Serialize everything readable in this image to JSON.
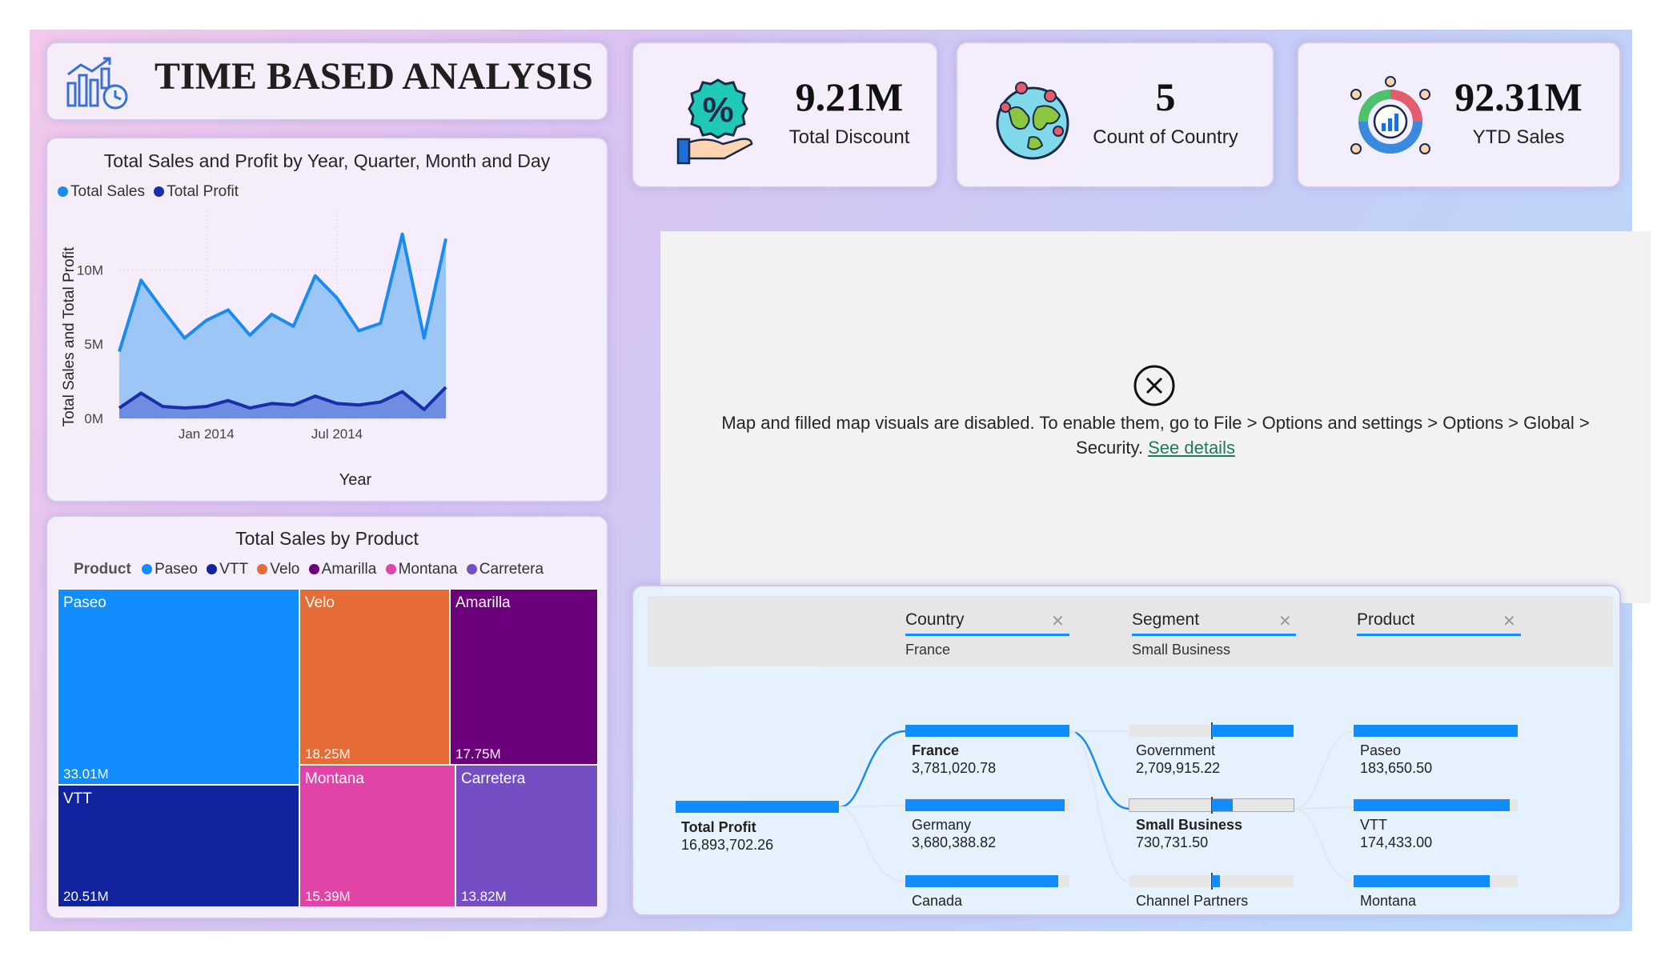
{
  "header": {
    "title": "TIME BASED ANALYSIS",
    "icon": "analytics-chart-icon"
  },
  "kpis": [
    {
      "value": "9.21M",
      "label": "Total Discount",
      "icon": "discount-hand-icon"
    },
    {
      "value": "5",
      "label": "Count of Country",
      "icon": "globe-pins-icon"
    },
    {
      "value": "92.31M",
      "label": "YTD Sales",
      "icon": "people-chart-icon"
    }
  ],
  "area_chart": {
    "title": "Total Sales and Profit by Year, Quarter, Month and Day",
    "legend": [
      {
        "name": "Total Sales",
        "color": "#1a8cf0"
      },
      {
        "name": "Total Profit",
        "color": "#1a2ea8"
      }
    ],
    "ylabel": "Total Sales and Total Profit",
    "xlabel": "Year",
    "y_ticks": [
      "0M",
      "5M",
      "10M"
    ],
    "x_ticks": [
      "Jan 2014",
      "Jul 2014"
    ]
  },
  "treemap": {
    "title": "Total Sales by Product",
    "legend_title": "Product",
    "legend": [
      {
        "name": "Paseo",
        "color": "#118dff"
      },
      {
        "name": "VTT",
        "color": "#12239e"
      },
      {
        "name": "Velo",
        "color": "#e66c37"
      },
      {
        "name": "Amarilla",
        "color": "#6b007b"
      },
      {
        "name": "Montana",
        "color": "#e044a7"
      },
      {
        "name": "Carretera",
        "color": "#744ec2"
      }
    ],
    "cells": [
      {
        "name": "Paseo",
        "value": "33.01M"
      },
      {
        "name": "Velo",
        "value": "18.25M"
      },
      {
        "name": "Amarilla",
        "value": "17.75M"
      },
      {
        "name": "VTT",
        "value": "20.51M"
      },
      {
        "name": "Montana",
        "value": "15.39M"
      },
      {
        "name": "Carretera",
        "value": "13.82M"
      }
    ]
  },
  "map_panel": {
    "message": "Map and filled map visuals are disabled. To enable them, go to File > Options and settings > Options > Global > Security.",
    "link": "See details",
    "icon": "close-circle-icon"
  },
  "decomposition_tree": {
    "columns": [
      {
        "title": "Country",
        "selected": "France"
      },
      {
        "title": "Segment",
        "selected": "Small Business"
      },
      {
        "title": "Product",
        "selected": ""
      }
    ],
    "root": {
      "label": "Total Profit",
      "value": "16,893,702.26"
    },
    "country_nodes": [
      {
        "label": "France",
        "value": "3,781,020.78",
        "fill": 1.0
      },
      {
        "label": "Germany",
        "value": "3,680,388.82",
        "fill": 0.97
      },
      {
        "label": "Canada",
        "value": "",
        "fill": 0.93
      }
    ],
    "segment_nodes": [
      {
        "label": "Government",
        "value": "2,709,915.22",
        "fill": 0.5
      },
      {
        "label": "Small Business",
        "value": "730,731.50",
        "fill": 0.13
      },
      {
        "label": "Channel Partners",
        "value": "",
        "fill": 0.05
      }
    ],
    "product_nodes": [
      {
        "label": "Paseo",
        "value": "183,650.50",
        "fill": 1.0
      },
      {
        "label": "VTT",
        "value": "174,433.00",
        "fill": 0.95
      },
      {
        "label": "Montana",
        "value": "",
        "fill": 0.83
      }
    ]
  },
  "chart_data": {
    "type": "area",
    "title": "Total Sales and Profit by Year, Quarter, Month and Day",
    "xlabel": "Year",
    "ylabel": "Total Sales and Total Profit",
    "x": [
      "Sep 2013",
      "Oct 2013",
      "Nov 2013",
      "Dec 2013",
      "Jan 2014",
      "Feb 2014",
      "Mar 2014",
      "Apr 2014",
      "May 2014",
      "Jun 2014",
      "Jul 2014",
      "Aug 2014",
      "Sep 2014",
      "Oct 2014",
      "Nov 2014",
      "Dec 2014"
    ],
    "x_tick_labels": [
      "Jan 2014",
      "Jul 2014"
    ],
    "ylim": [
      0,
      14000000
    ],
    "y_ticks": [
      "0M",
      "5M",
      "10M"
    ],
    "series": [
      {
        "name": "Total Sales",
        "color": "#1a8cf0",
        "values": [
          4500000,
          9300000,
          7300000,
          5400000,
          6600000,
          7300000,
          5600000,
          7000000,
          6200000,
          9600000,
          8100000,
          5900000,
          6400000,
          12400000,
          5400000,
          12100000
        ]
      },
      {
        "name": "Total Profit",
        "color": "#1a2ea8",
        "values": [
          700000,
          1700000,
          800000,
          700000,
          800000,
          1200000,
          700000,
          1000000,
          900000,
          1500000,
          1000000,
          900000,
          1100000,
          1800000,
          600000,
          2100000
        ]
      }
    ],
    "grid": true,
    "legend": "top-left"
  }
}
